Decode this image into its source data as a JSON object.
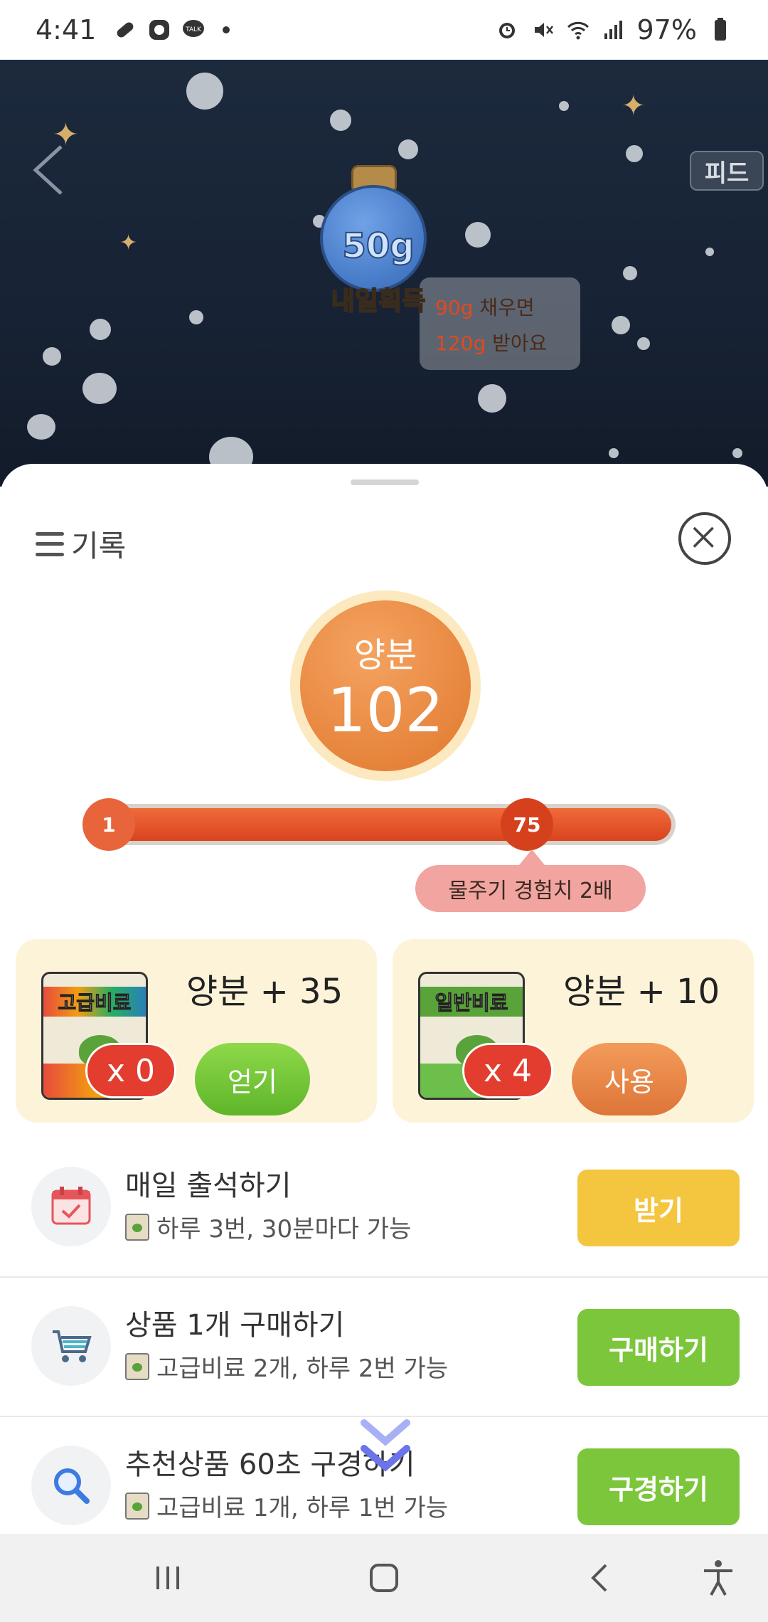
{
  "status_bar": {
    "time": "4:41",
    "battery": "97%",
    "icons_left": [
      "pill-icon",
      "b-app-icon",
      "kakaotalk-icon"
    ],
    "kakao_label": "TALK",
    "icons_right": [
      "alarm-icon",
      "mute-icon",
      "wifi-icon",
      "signal-icon",
      "battery-icon"
    ]
  },
  "header": {
    "feed_label": "피드"
  },
  "jar": {
    "amount": "50g",
    "label": "내일획득",
    "bubble_line1_hl": "90g",
    "bubble_line1_rest": " 채우면",
    "bubble_line2_hl": "120g",
    "bubble_line2_rest": " 받아요"
  },
  "sheet": {
    "history_label": "기록",
    "nutrient_label": "양분",
    "nutrient_value": "102",
    "progress": {
      "start_level": "1",
      "current_level": "75",
      "tooltip": "물주기 경험치 2배"
    },
    "cards": [
      {
        "bag_label": "고급비료",
        "count": "x 0",
        "title": "양분 + 35",
        "button": "얻기"
      },
      {
        "bag_label": "일반비료",
        "count": "x 4",
        "title": "양분 + 10",
        "button": "사용"
      }
    ],
    "tasks": [
      {
        "title": "매일 출석하기",
        "sub": "하루 3번, 30분마다 가능",
        "button": "받기",
        "icon": "calendar-check-icon"
      },
      {
        "title": "상품 1개 구매하기",
        "sub": "고급비료 2개, 하루 2번 가능",
        "button": "구매하기",
        "icon": "cart-icon"
      },
      {
        "title": "추천상품 60초 구경하기",
        "sub": "고급비료 1개, 하루 1번 가능",
        "button": "구경하기",
        "icon": "magnifier-icon"
      }
    ]
  },
  "colors": {
    "accent_orange": "#e1782e",
    "accent_green": "#7cc63b",
    "accent_yellow": "#f4c53e",
    "badge_red": "#e23d2e"
  }
}
